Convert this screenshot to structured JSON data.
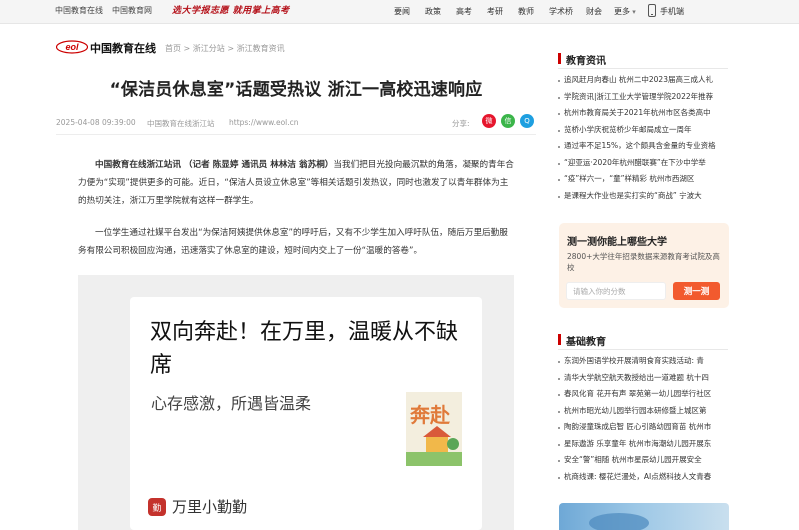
{
  "topbar": {
    "left_links": [
      "中国教育在线",
      "中国教育网"
    ],
    "slogan": "选大学报志愿 就用掌上高考",
    "nav": [
      "要闻",
      "政策",
      "高考",
      "考研",
      "教师",
      "学术桥",
      "财会",
      "更多"
    ],
    "mobile": "手机端"
  },
  "header": {
    "logo_text": "中国教育在线",
    "logo_mark": "eol",
    "breadcrumb": "首页 > 浙江分站 > 浙江教育资讯"
  },
  "article": {
    "title": "“保洁员休息室”话题受热议 浙江一高校迅速响应",
    "date": "2025-04-08 09:39:00",
    "source": "中国教育在线浙江站",
    "url": "https://www.eol.cn",
    "share_label": "分享:",
    "p1_lead": "中国教育在线浙江站讯 （记者 陈显婷 通讯员 林林洁 翁苏桐）",
    "p1_rest": "当我们把目光投向最沉默的角落，凝聚的青年合力便为“实现”提供更多的可能。近日，“保洁人员设立休息室”等相关话题引发热议，同时也激发了以青年群体为主的热切关注，浙江万里学院就有这样一群学生。",
    "p2": "一位学生通过社媒平台发出“为保洁阿姨提供休息室”的呼吁后，又有不少学生加入呼吁队伍，随后万里后勤服务有限公司积极回应沟通，迅速落实了休息室的建设，短时间内交上了一份“温暖的答卷”。",
    "image": {
      "headline": "双向奔赴！在万里，温暖从不缺席",
      "sub": "心存感激，所遇皆温柔",
      "art_text": "奔赴",
      "badge": "勤",
      "brand": "万里小勤勤"
    }
  },
  "sidebar": {
    "news_title": "教育资讯",
    "news": [
      "追风赶月向春山 杭州二中2023届高三成人礼",
      "学院资讯|浙江工业大学管理学院2022年推荐",
      "杭州市教育局关于2021年杭州市区各类高中",
      "览桥小学庆祝览桥少年邮局成立一周年",
      "通过率不足15%，这个颇具含金量的专业资格",
      "“迎亚运·2020年杭州醋联赛”在下沙中学举",
      "“疫”样六一，“童”样精彩 杭州市西湖区",
      "是课程大作业也是实打实的“商战” 宁波大"
    ],
    "test": {
      "title": "测一测你能上哪些大学",
      "desc": "2800+大学往年招录数据来源教育考试院及高校",
      "placeholder": "请输入你的分数",
      "button": "测一测"
    },
    "basic_title": "基础教育",
    "basic": [
      "东润外国语学校开展清明食育实践活动: 青",
      "清华大学航空航天教授给出一道难题 杭十四",
      "春风化育 花开有声 翠苑第一幼儿园举行社区",
      "杭州市昭光幼儿园举行园本研修暨上城区第",
      "陶韵浸童珠成启智 匠心引路幼园育苗 杭州市",
      "星际遨游 乐享童年 杭州市海潮幼儿园开展东",
      "安全“警”相随 杭州市星辰幼儿园开展安全",
      "杭商线课: 樱花烂漫处，AI点燃科技人文青春"
    ]
  },
  "colors": {
    "brand_red": "#c00000",
    "test_button": "#f25a2e",
    "test_bg": "#fdf1e6"
  }
}
